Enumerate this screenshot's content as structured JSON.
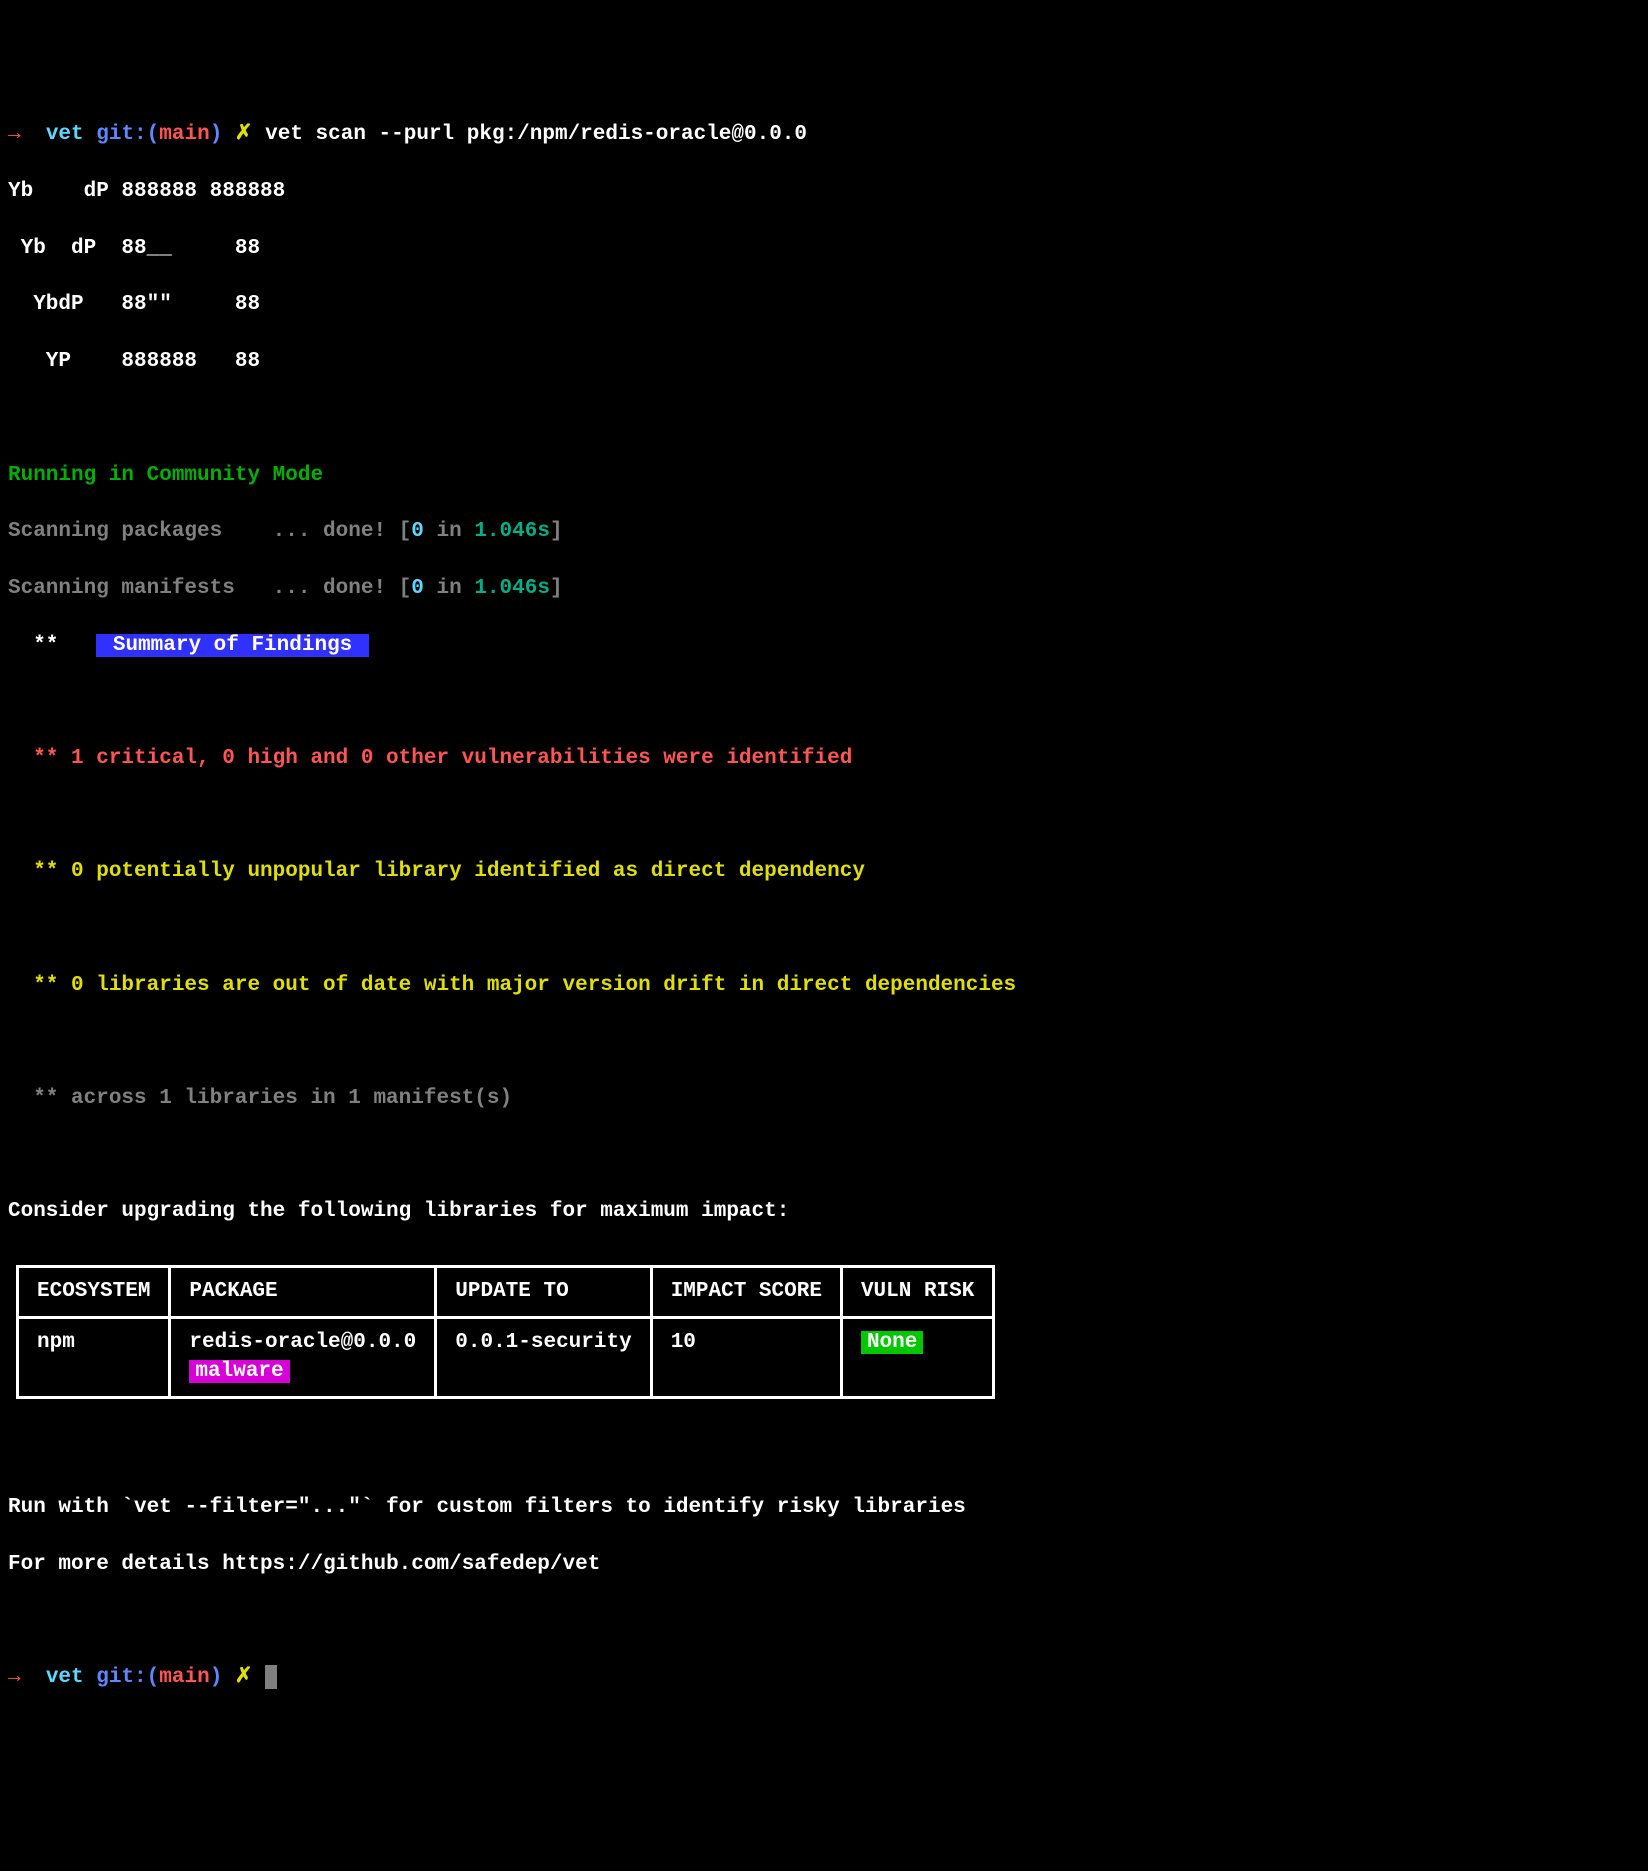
{
  "prompt1": {
    "arrow": "→",
    "dir": "vet",
    "git_prefix": "git:(",
    "branch": "main",
    "git_suffix": ")",
    "dirty": "✗",
    "command": "vet scan --purl pkg:/npm/redis-oracle@0.0.0"
  },
  "ascii_art": [
    "Yb    dP 888888 888888",
    " Yb  dP  88__     88",
    "  YbdP   88\"\"     88",
    "   YP    888888   88"
  ],
  "mode_line": "Running in Community Mode",
  "scan_lines": [
    {
      "label": "Scanning packages    ... done!",
      "bracket_open": " [",
      "count": "0",
      "in": " in ",
      "time": "1.046s",
      "bracket_close": "]"
    },
    {
      "label": "Scanning manifests   ... done!",
      "bracket_open": " [",
      "count": "0",
      "in": " in ",
      "time": "1.046s",
      "bracket_close": "]"
    }
  ],
  "summary_stars": "  ** ",
  "summary_label": " Summary of Findings ",
  "findings": {
    "critical": "  ** 1 critical, 0 high and 0 other vulnerabilities were identified",
    "unpopular": "  ** 0 potentially unpopular library identified as direct dependency",
    "drift": "  ** 0 libraries are out of date with major version drift in direct dependencies",
    "across": "  ** across 1 libraries in 1 manifest(s)"
  },
  "upgrade_heading": "Consider upgrading the following libraries for maximum impact:",
  "table": {
    "headers": [
      "ECOSYSTEM",
      "PACKAGE",
      "UPDATE TO",
      "IMPACT SCORE",
      "VULN RISK"
    ],
    "rows": [
      {
        "ecosystem": "npm",
        "package": "redis-oracle@0.0.0",
        "package_badge": "malware",
        "update_to": "0.0.1-security",
        "impact": "10",
        "risk": "None"
      }
    ]
  },
  "footer1_pre": "Run with `",
  "footer1_cmd": "vet --filter=\"...\"",
  "footer1_post": "` for custom filters to identify risky libraries",
  "footer2_pre": "For more details ",
  "footer2_url": "https://github.com/safedep/vet",
  "prompt2": {
    "arrow": "→",
    "dir": "vet",
    "git_prefix": "git:(",
    "branch": "main",
    "git_suffix": ")",
    "dirty": "✗"
  }
}
